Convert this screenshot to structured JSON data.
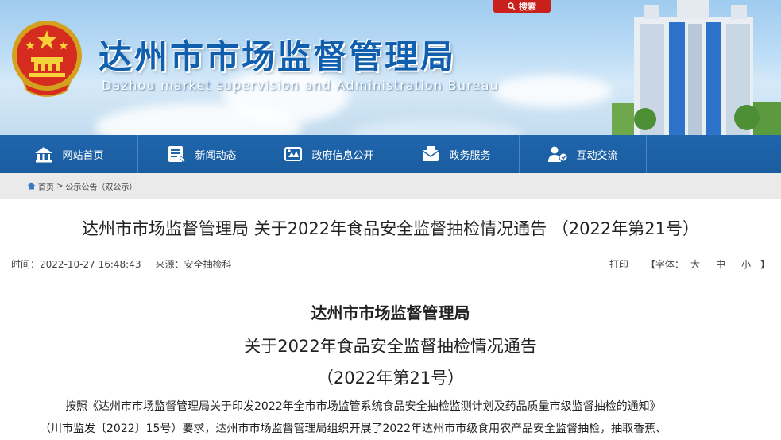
{
  "banner": {
    "title": "达州市市场监督管理局",
    "subtitle": "Dazhou market supervision and Administration Bureau",
    "search_label": "搜索"
  },
  "nav": {
    "items": [
      {
        "label": "网站首页",
        "icon": "home-icon"
      },
      {
        "label": "新闻动态",
        "icon": "news-icon"
      },
      {
        "label": "政府信息公开",
        "icon": "info-disclosure-icon"
      },
      {
        "label": "政务服务",
        "icon": "service-icon"
      },
      {
        "label": "互动交流",
        "icon": "interaction-icon"
      }
    ]
  },
  "breadcrumb": {
    "home": "首页",
    "separator": ">",
    "current": "公示公告（双公示）"
  },
  "article": {
    "title": "达州市市场监督管理局 关于2022年食品安全监督抽检情况通告 （2022年第21号）",
    "time_label": "时间：",
    "time": "2022-10-27 16:48:43",
    "source_label": "来源：",
    "source": "安全抽检科",
    "print_label": "打印",
    "font_label": "【字体：",
    "font_large": "大",
    "font_medium": "中",
    "font_small": "小",
    "font_close": "】",
    "heading_org": "达州市市场监督管理局",
    "heading_subject": "关于2022年食品安全监督抽检情况通告",
    "heading_number": "（2022年第21号）",
    "paragraph_line1": "按照《达州市市场监督管理局关于印发2022年全市市场监管系统食品安全抽检监测计划及药品质量市级监督抽检的通知》",
    "paragraph_line2": "（川市监发〔2022〕15号）要求，达州市市场监督管理局组织开展了2022年达州市市级食用农产品安全监督抽检，抽取香蕉、"
  },
  "colors": {
    "nav_bg": "#1f66ad",
    "title_blue": "#0f5fae",
    "search_red": "#c9201b",
    "breadcrumb_bg": "#eaeaea"
  }
}
